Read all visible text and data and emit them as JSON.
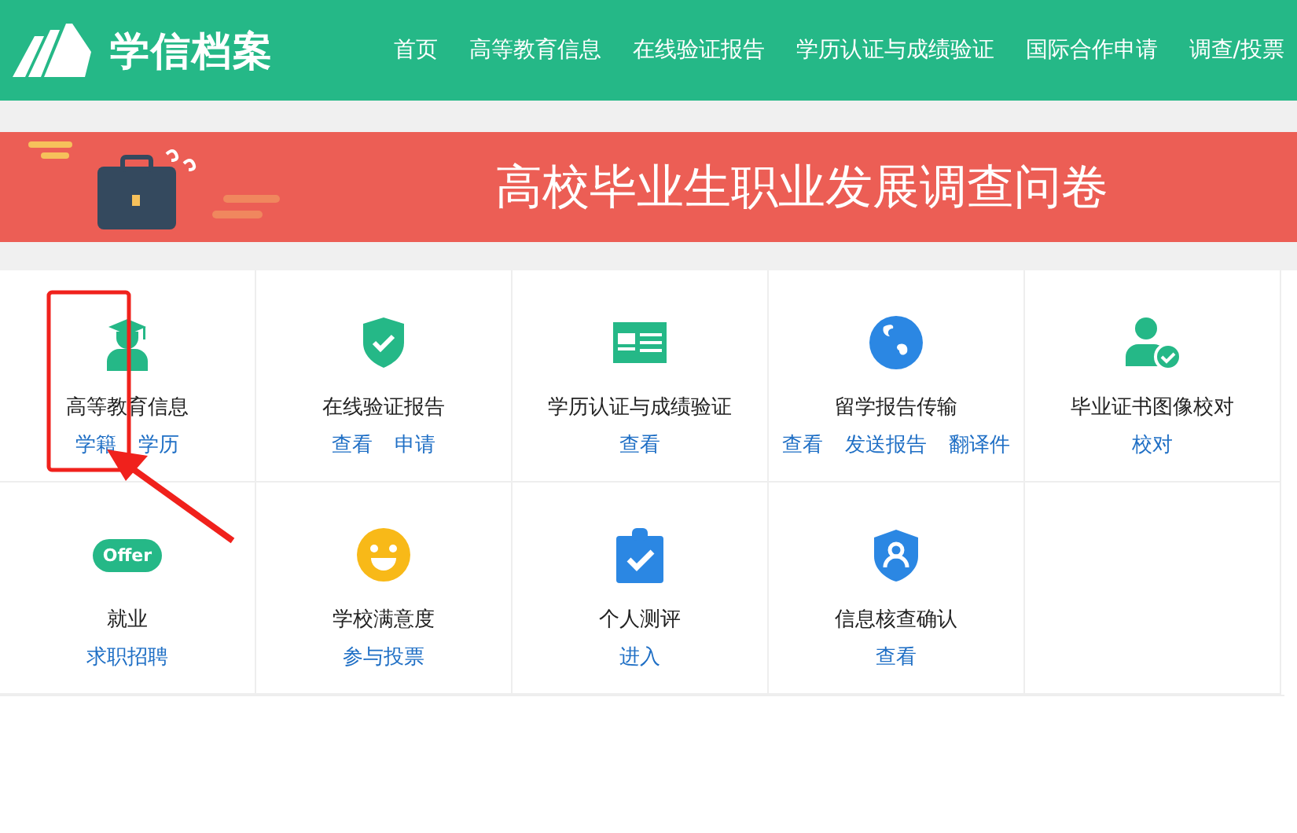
{
  "header": {
    "logo_text": "学信档案",
    "nav": [
      {
        "label": "首页"
      },
      {
        "label": "高等教育信息"
      },
      {
        "label": "在线验证报告"
      },
      {
        "label": "学历认证与成绩验证"
      },
      {
        "label": "国际合作申请"
      },
      {
        "label": "调查/投票"
      }
    ]
  },
  "banner": {
    "title": "高校毕业生职业发展调查问卷"
  },
  "services": [
    {
      "kind": "graduate",
      "title": "高等教育信息",
      "links": [
        "学籍",
        "学历"
      ]
    },
    {
      "kind": "shield-check",
      "title": "在线验证报告",
      "links": [
        "查看",
        "申请"
      ]
    },
    {
      "kind": "id-card",
      "title": "学历认证与成绩验证",
      "links": [
        "查看"
      ]
    },
    {
      "kind": "globe",
      "title": "留学报告传输",
      "links": [
        "查看",
        "发送报告",
        "翻译件"
      ]
    },
    {
      "kind": "user-check",
      "title": "毕业证书图像校对",
      "links": [
        "校对"
      ]
    },
    {
      "kind": "offer",
      "badge": "Offer",
      "title": "就业",
      "links": [
        "求职招聘"
      ]
    },
    {
      "kind": "smile",
      "title": "学校满意度",
      "links": [
        "参与投票"
      ]
    },
    {
      "kind": "clipboard",
      "title": "个人测评",
      "links": [
        "进入"
      ]
    },
    {
      "kind": "shield-user",
      "title": "信息核查确认",
      "links": [
        "查看"
      ]
    }
  ]
}
